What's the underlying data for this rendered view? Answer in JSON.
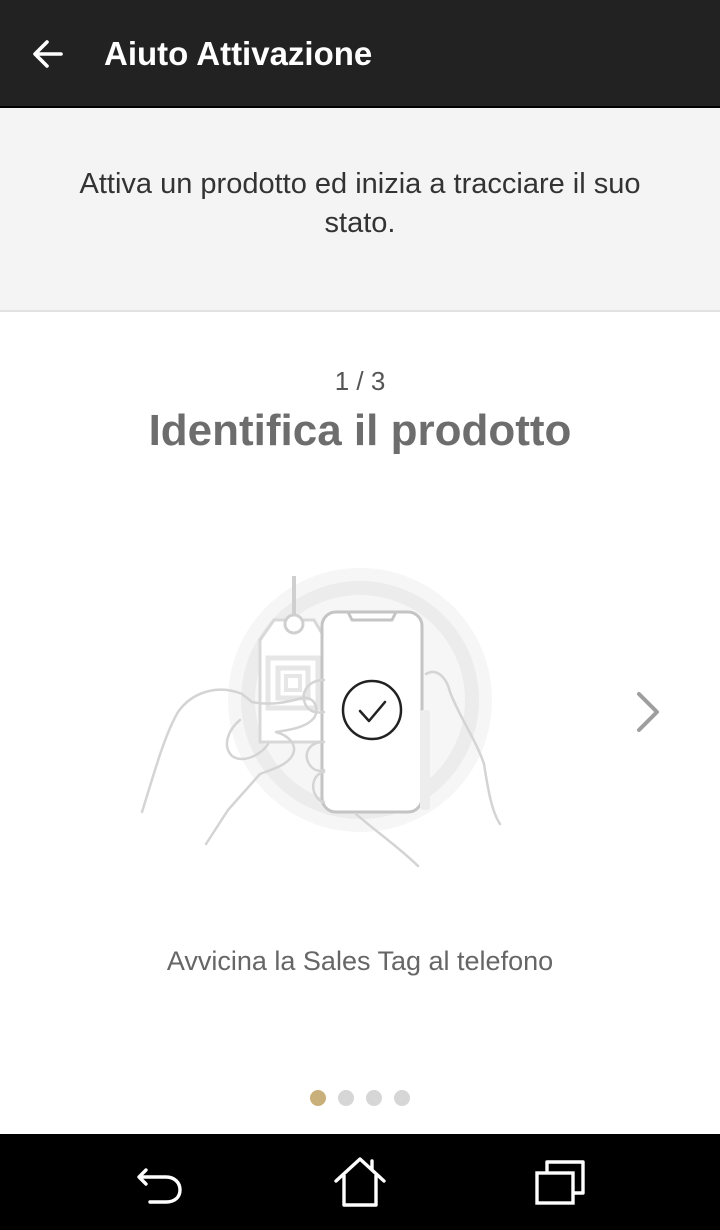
{
  "header": {
    "title": "Aiuto Attivazione",
    "back_icon": "arrow-left-icon"
  },
  "intro": {
    "text": "Attiva un prodotto ed inizia a tracciare il suo stato."
  },
  "step": {
    "counter": "1 / 3",
    "title": "Identifica il prodotto",
    "caption": "Avvicina la Sales Tag al telefono",
    "illustration_icon": "tag-phone-illustration",
    "next_icon": "chevron-right-icon"
  },
  "pager": {
    "total": 4,
    "active_index": 0,
    "active_color": "#c9b07a",
    "inactive_color": "#d6d6d6"
  },
  "system_nav": {
    "back_icon": "nav-back-icon",
    "home_icon": "nav-home-icon",
    "recents_icon": "nav-recents-icon"
  },
  "colors": {
    "appbar": "#222222",
    "intro_background": "#f4f4f4",
    "title_text": "#6d6d6d"
  }
}
